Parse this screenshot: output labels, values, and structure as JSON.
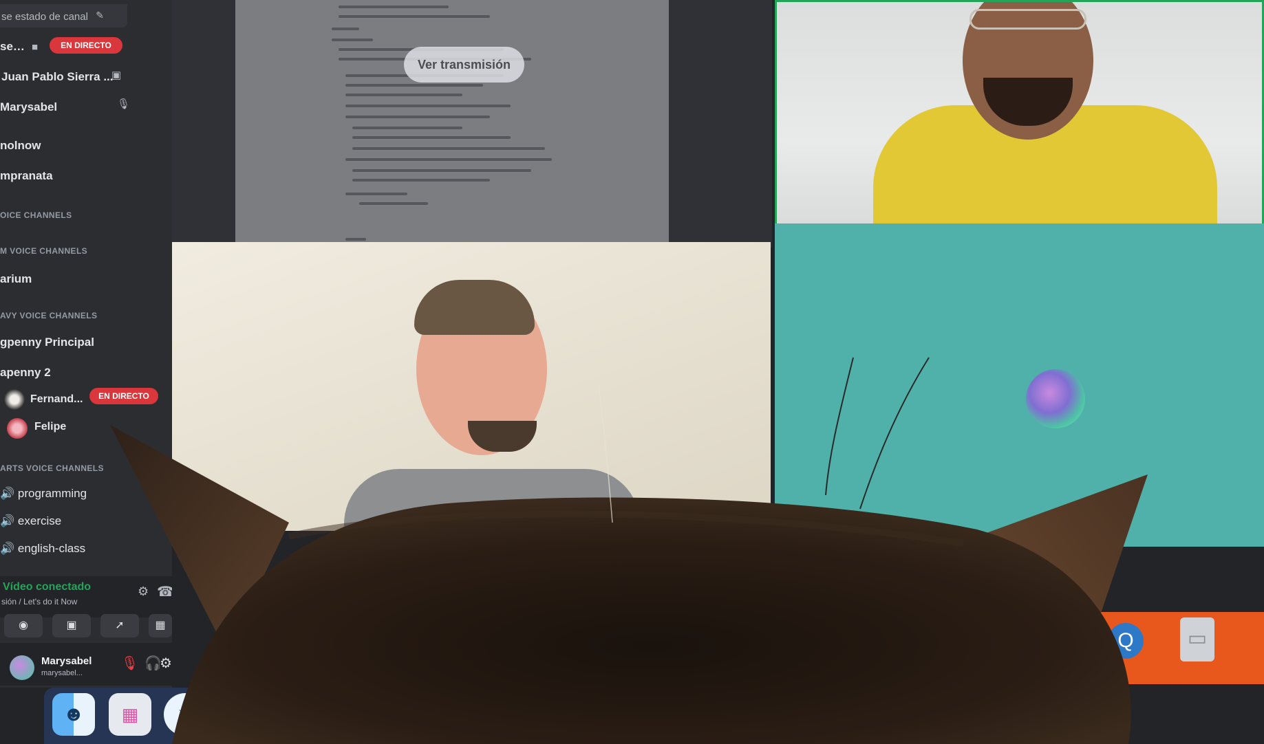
{
  "sidebar": {
    "status_text": "se estado de canal",
    "live_label": "EN DIRECTO",
    "items": [
      "Juan Pablo Sierra ...",
      "Marysabel",
      "nolnow",
      "mpranata",
      "arium",
      "gpenny Principal",
      "apenny 2",
      "Fernand...",
      "Felipe",
      "programming",
      "exercise",
      "english-class"
    ],
    "categories": [
      "OICE CHANNELS",
      "M VOICE CHANNELS",
      "AVY VOICE CHANNELS",
      "ARTS VOICE CHANNELS"
    ],
    "voice": {
      "status": "Vídeo conectado",
      "subtitle": "sión / Let's do it Now"
    },
    "user": {
      "name": "Marysabel",
      "subtitle": "marysabel..."
    }
  },
  "stream": {
    "watch_label": "Ver transmisión"
  },
  "icons": [
    "pencil-icon",
    "folder-icon",
    "mic-icon",
    "speaker-icon",
    "gear-icon",
    "phone-icon",
    "camera-icon",
    "screen-share-icon",
    "rocket-icon",
    "activity-icon",
    "mic-muted-icon",
    "headphones-icon",
    "finder-icon",
    "launchpad-icon",
    "safari-icon",
    "zoom-icon",
    "quicktime-icon",
    "trash-icon"
  ],
  "colors": {
    "sidebar_bg": "#2b2d31",
    "live_badge": "#da373c",
    "connected_green": "#23a559",
    "teal_tile": "#4fb1aa",
    "hoodie_yellow": "#e1c834"
  }
}
